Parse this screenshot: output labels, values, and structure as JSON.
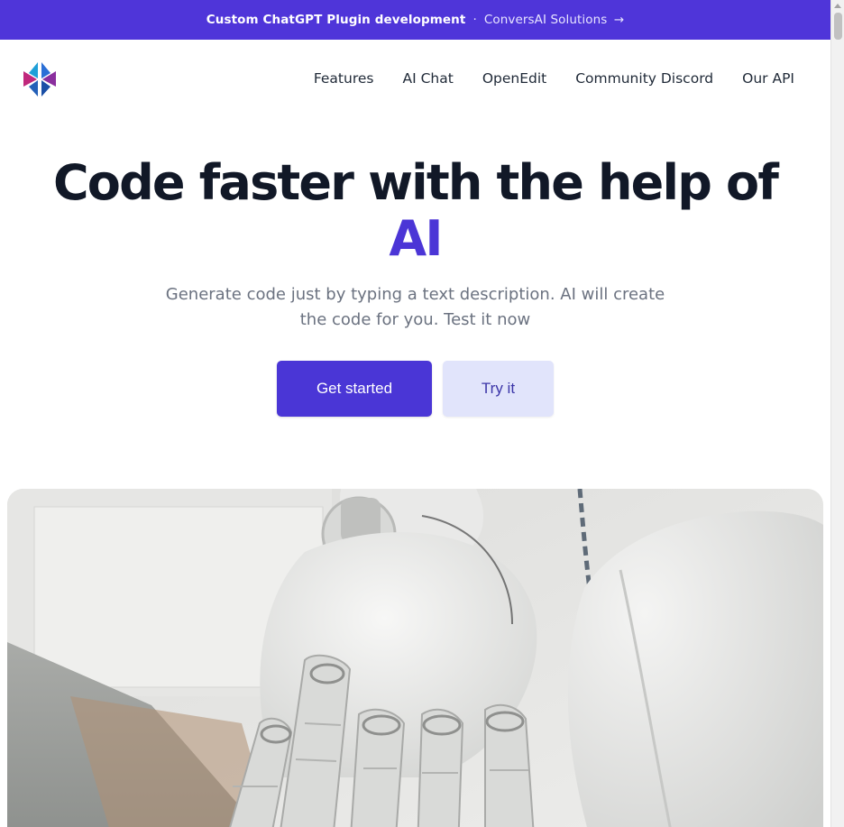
{
  "banner": {
    "headline": "Custom ChatGPT Plugin development",
    "separator": "·",
    "link_text": "ConversAI Solutions",
    "arrow": "→"
  },
  "nav": {
    "logo_icon": "asterisk-triangle-logo-icon",
    "links": [
      {
        "label": "Features"
      },
      {
        "label": "AI Chat"
      },
      {
        "label": "OpenEdit"
      },
      {
        "label": "Community Discord"
      },
      {
        "label": "Our API"
      }
    ]
  },
  "hero": {
    "title_main": "Code faster with the help of",
    "title_accent": "AI",
    "subtitle": "Generate code just by typing a text description. AI will create the code for you. Test it now",
    "primary_button": "Get started",
    "secondary_button": "Try it"
  },
  "colors": {
    "brand": "#4f35d9",
    "accent_text": "#4b35d6",
    "secondary_button_bg": "#e1e4fb"
  }
}
